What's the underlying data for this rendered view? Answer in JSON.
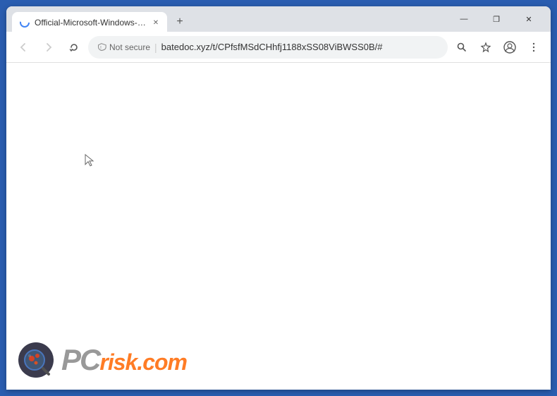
{
  "browser": {
    "tab": {
      "title": "Official-Microsoft-Windows-Help",
      "favicon": "loading-icon"
    },
    "new_tab_label": "+",
    "window_controls": {
      "minimize": "—",
      "restore": "❐",
      "close": "✕"
    },
    "toolbar": {
      "back_label": "←",
      "forward_label": "→",
      "reload_label": "✕",
      "security_text": "Not secure",
      "address_divider": "|",
      "address_url": "batedoc.xyz/t/CPfsfMSdCHhfj1188xSS08ViBWSS0B/#",
      "search_icon": "search-icon",
      "bookmark_icon": "star-icon",
      "account_icon": "account-icon",
      "menu_icon": "menu-icon"
    }
  },
  "watermark": {
    "logo_alt": "pcrisk logo",
    "text_pc": "PC",
    "text_risk_com": "risk.com"
  }
}
